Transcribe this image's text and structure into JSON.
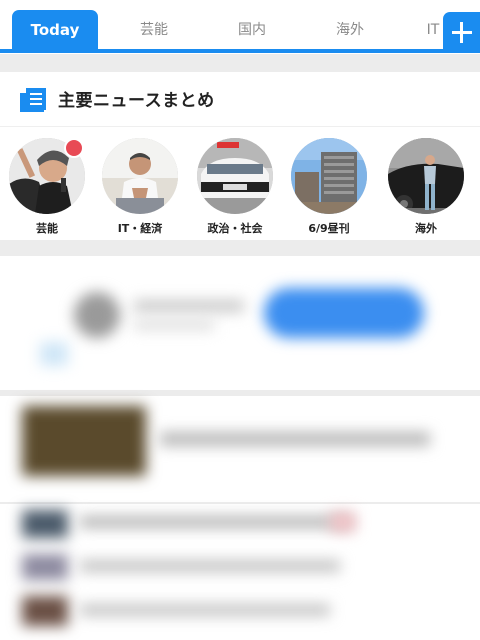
{
  "tabs": [
    {
      "label": "Today",
      "active": true
    },
    {
      "label": "芸能",
      "active": false
    },
    {
      "label": "国内",
      "active": false
    },
    {
      "label": "海外",
      "active": false
    },
    {
      "label": "IT",
      "active": false
    }
  ],
  "add_button_icon": "plus-icon",
  "digest": {
    "title": "主要ニュースまとめ",
    "icon": "newspaper-icon",
    "categories": [
      {
        "label": "芸能",
        "has_badge": true
      },
      {
        "label": "IT・経済",
        "has_badge": false
      },
      {
        "label": "政治・社会",
        "has_badge": false
      },
      {
        "label": "6/9昼刊",
        "has_badge": false
      },
      {
        "label": "海外",
        "has_badge": false
      }
    ]
  },
  "colors": {
    "accent": "#1a8cf0",
    "badge": "#e84a55",
    "background": "#ececec"
  }
}
